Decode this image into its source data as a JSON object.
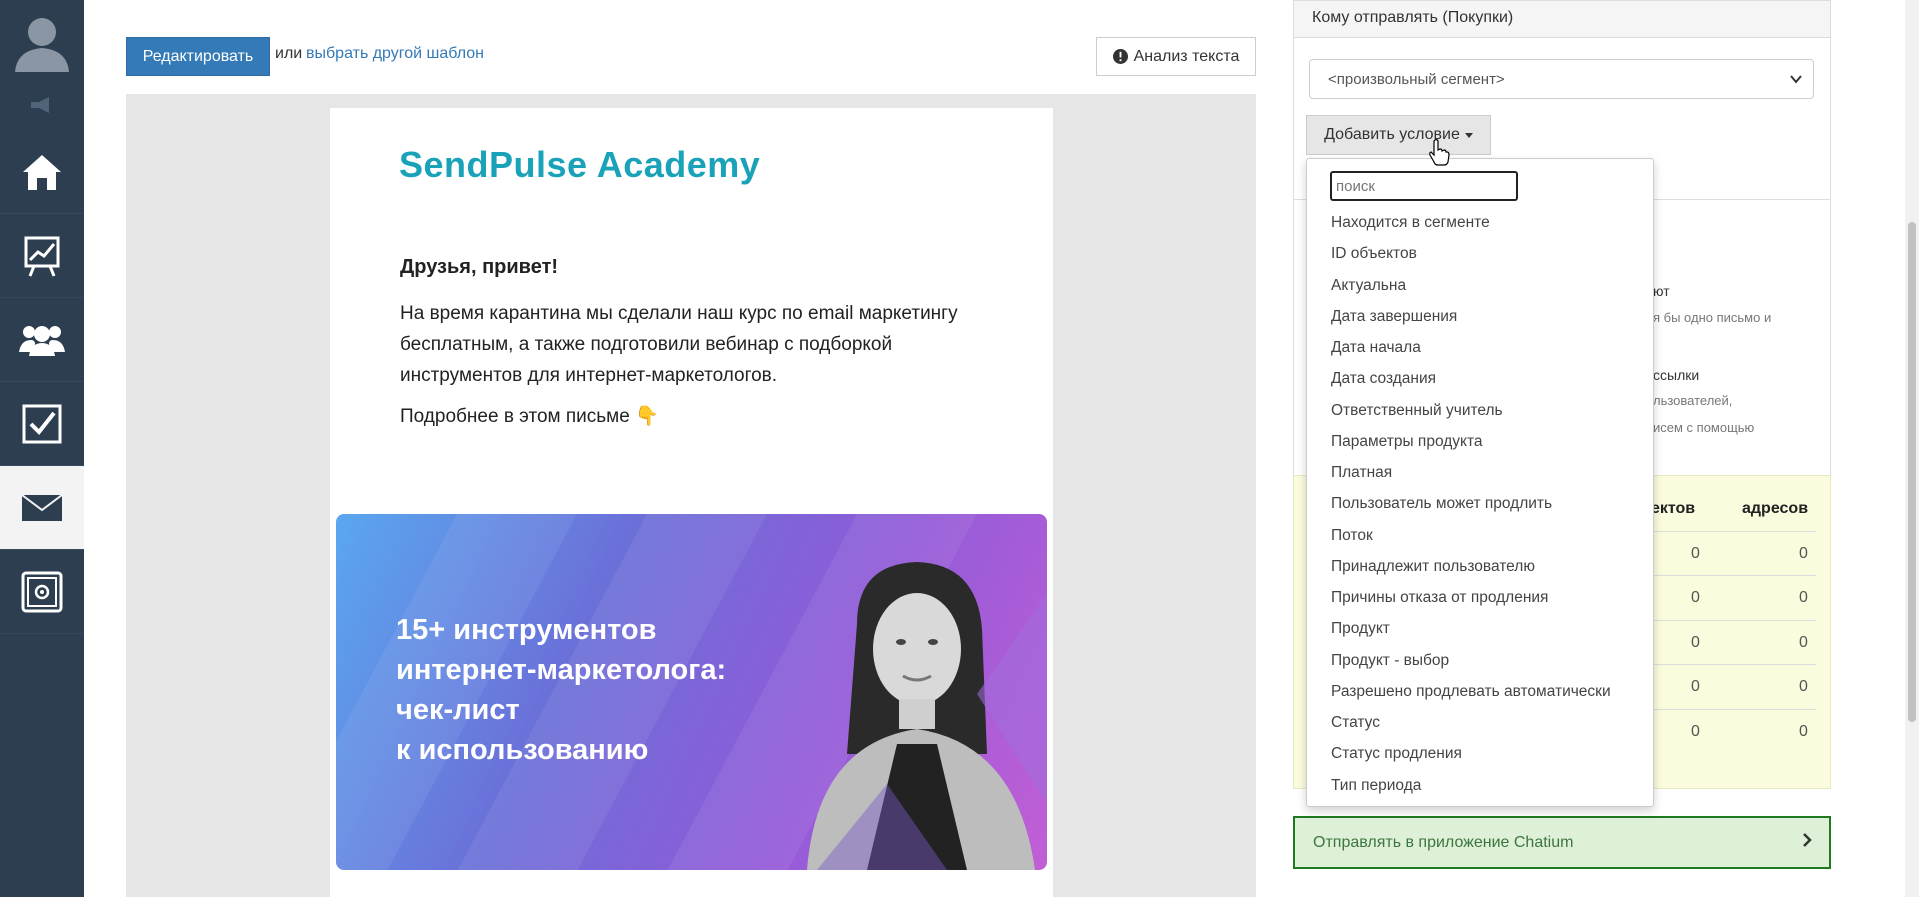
{
  "sidebar": {
    "items": [
      {
        "icon": "home-icon"
      },
      {
        "icon": "chart-icon"
      },
      {
        "icon": "users-icon"
      },
      {
        "icon": "tasks-icon"
      },
      {
        "icon": "mail-icon",
        "active": true
      },
      {
        "icon": "safe-icon"
      }
    ],
    "colors": {
      "background": "#2c3e50",
      "active": "#f3f3f3"
    }
  },
  "toolbar": {
    "edit_label": "Редактировать",
    "or_text": "или",
    "template_link": "выбрать другой шаблон",
    "analysis_label": "Анализ текста"
  },
  "letter": {
    "logo": "SendPulse Academy",
    "greeting": "Друзья, привет!",
    "paragraph": "На время карантина мы сделали наш курс по email маркетингу бесплатным, а также подготовили вебинар с подборкой инструментов для интернет-маркетологов.",
    "more": "Подробнее в этом письме 👇",
    "banner_title_lines": [
      "15+ инструментов",
      "интернет-маркетолога:",
      "чек-лист",
      "к использованию"
    ]
  },
  "panel": {
    "header": "Кому отправлять (Покупки)",
    "segment_value": "<произвольный сегмент>",
    "add_condition": "Добавить условие",
    "bg_texts": {
      "uyut": "ют",
      "line1": "я бы одно письмо и",
      "rassylki": "ссылки",
      "users": "льзователей,",
      "pomoschyu": "исем с помощью"
    },
    "stats": {
      "col1": "ектов",
      "col2": "адресов",
      "rows": [
        [
          "0",
          "0"
        ],
        [
          "0",
          "0"
        ],
        [
          "0",
          "0"
        ],
        [
          "0",
          "0"
        ],
        [
          "0",
          "0"
        ]
      ]
    },
    "chatium": "Отправлять в приложение Chatium"
  },
  "dropdown": {
    "search_placeholder": "поиск",
    "items": [
      "Находится в сегменте",
      "ID объектов",
      "Актуальна",
      "Дата завершения",
      "Дата начала",
      "Дата создания",
      "Ответственный учитель",
      "Параметры продукта",
      "Платная",
      "Пользователь может продлить",
      "Поток",
      "Принадлежит пользователю",
      "Причины отказа от продления",
      "Продукт",
      "Продукт - выбор",
      "Разрешено продлевать автоматически",
      "Статус",
      "Статус продления",
      "Тип периода"
    ]
  },
  "colors": {
    "primary": "#337ab7",
    "logo": "#1aa3b8",
    "stats_bg": "#fbfbdd",
    "chatium_bg": "#dff0d8",
    "chatium_border": "#1f7a1f"
  }
}
